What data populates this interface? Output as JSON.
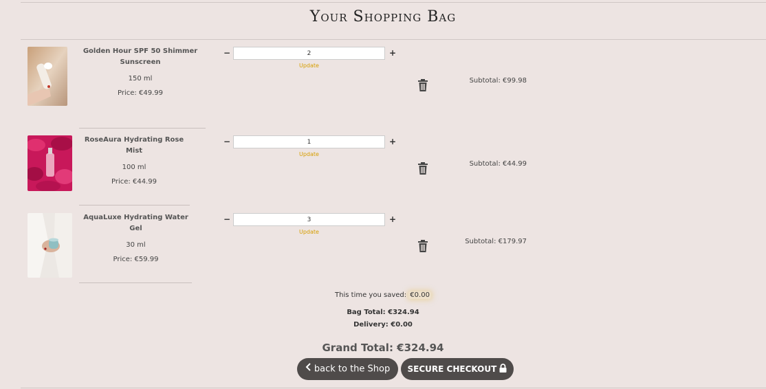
{
  "page": {
    "title": "Your Shopping Bag"
  },
  "items": [
    {
      "name": "Golden Hour SPF 50 Shimmer Sunscreen",
      "size": "150 ml",
      "price": "Price: €49.99",
      "quantity": "2",
      "update": "Update",
      "subtotal": "Subtotal: €99.98",
      "minus": "−",
      "plus": "+"
    },
    {
      "name": "RoseAura Hydrating Rose Mist",
      "size": "100 ml",
      "price": "Price: €44.99",
      "quantity": "1",
      "update": "Update",
      "subtotal": "Subtotal: €44.99",
      "minus": "−",
      "plus": "+"
    },
    {
      "name": "AquaLuxe Hydrating Water Gel",
      "size": "30 ml",
      "price": "Price: €59.99",
      "quantity": "3",
      "update": "Update",
      "subtotal": "Subtotal: €179.97",
      "minus": "−",
      "plus": "+"
    }
  ],
  "summary": {
    "saved_label": "This time you saved:",
    "saved_value": "€0.00",
    "bag_total": "Bag Total: €324.94",
    "delivery": "Delivery: €0.00",
    "grand_total": "Grand Total: €324.94"
  },
  "buttons": {
    "back": "back to the Shop",
    "checkout": "SECURE CHECKOUT"
  },
  "icons": {
    "trash": "trash-icon",
    "back": "chevron-left-icon",
    "checkout": "lock-icon"
  },
  "colors": {
    "accent": "#d69e00",
    "button": "#4f4b4a",
    "background": "#ede4e2"
  }
}
